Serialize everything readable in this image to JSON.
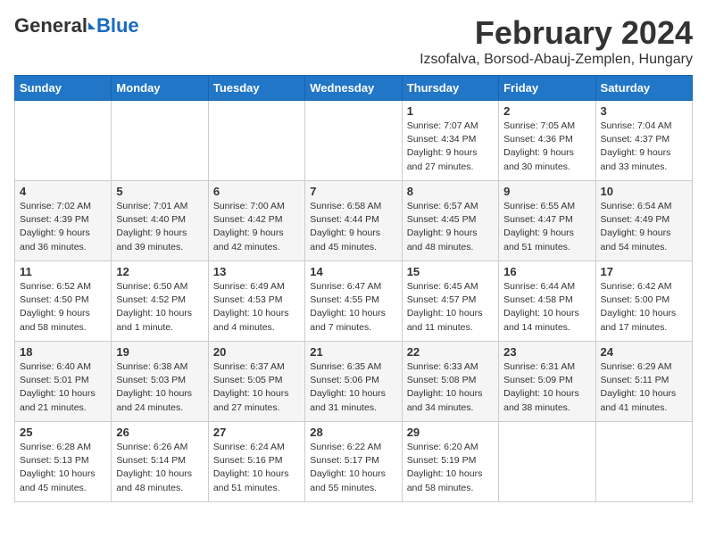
{
  "logo": {
    "general": "General",
    "blue": "Blue"
  },
  "header": {
    "title": "February 2024",
    "subtitle": "Izsofalva, Borsod-Abauj-Zemplen, Hungary"
  },
  "weekdays": [
    "Sunday",
    "Monday",
    "Tuesday",
    "Wednesday",
    "Thursday",
    "Friday",
    "Saturday"
  ],
  "weeks": [
    [
      {
        "day": "",
        "info": ""
      },
      {
        "day": "",
        "info": ""
      },
      {
        "day": "",
        "info": ""
      },
      {
        "day": "",
        "info": ""
      },
      {
        "day": "1",
        "info": "Sunrise: 7:07 AM\nSunset: 4:34 PM\nDaylight: 9 hours and 27 minutes."
      },
      {
        "day": "2",
        "info": "Sunrise: 7:05 AM\nSunset: 4:36 PM\nDaylight: 9 hours and 30 minutes."
      },
      {
        "day": "3",
        "info": "Sunrise: 7:04 AM\nSunset: 4:37 PM\nDaylight: 9 hours and 33 minutes."
      }
    ],
    [
      {
        "day": "4",
        "info": "Sunrise: 7:02 AM\nSunset: 4:39 PM\nDaylight: 9 hours and 36 minutes."
      },
      {
        "day": "5",
        "info": "Sunrise: 7:01 AM\nSunset: 4:40 PM\nDaylight: 9 hours and 39 minutes."
      },
      {
        "day": "6",
        "info": "Sunrise: 7:00 AM\nSunset: 4:42 PM\nDaylight: 9 hours and 42 minutes."
      },
      {
        "day": "7",
        "info": "Sunrise: 6:58 AM\nSunset: 4:44 PM\nDaylight: 9 hours and 45 minutes."
      },
      {
        "day": "8",
        "info": "Sunrise: 6:57 AM\nSunset: 4:45 PM\nDaylight: 9 hours and 48 minutes."
      },
      {
        "day": "9",
        "info": "Sunrise: 6:55 AM\nSunset: 4:47 PM\nDaylight: 9 hours and 51 minutes."
      },
      {
        "day": "10",
        "info": "Sunrise: 6:54 AM\nSunset: 4:49 PM\nDaylight: 9 hours and 54 minutes."
      }
    ],
    [
      {
        "day": "11",
        "info": "Sunrise: 6:52 AM\nSunset: 4:50 PM\nDaylight: 9 hours and 58 minutes."
      },
      {
        "day": "12",
        "info": "Sunrise: 6:50 AM\nSunset: 4:52 PM\nDaylight: 10 hours and 1 minute."
      },
      {
        "day": "13",
        "info": "Sunrise: 6:49 AM\nSunset: 4:53 PM\nDaylight: 10 hours and 4 minutes."
      },
      {
        "day": "14",
        "info": "Sunrise: 6:47 AM\nSunset: 4:55 PM\nDaylight: 10 hours and 7 minutes."
      },
      {
        "day": "15",
        "info": "Sunrise: 6:45 AM\nSunset: 4:57 PM\nDaylight: 10 hours and 11 minutes."
      },
      {
        "day": "16",
        "info": "Sunrise: 6:44 AM\nSunset: 4:58 PM\nDaylight: 10 hours and 14 minutes."
      },
      {
        "day": "17",
        "info": "Sunrise: 6:42 AM\nSunset: 5:00 PM\nDaylight: 10 hours and 17 minutes."
      }
    ],
    [
      {
        "day": "18",
        "info": "Sunrise: 6:40 AM\nSunset: 5:01 PM\nDaylight: 10 hours and 21 minutes."
      },
      {
        "day": "19",
        "info": "Sunrise: 6:38 AM\nSunset: 5:03 PM\nDaylight: 10 hours and 24 minutes."
      },
      {
        "day": "20",
        "info": "Sunrise: 6:37 AM\nSunset: 5:05 PM\nDaylight: 10 hours and 27 minutes."
      },
      {
        "day": "21",
        "info": "Sunrise: 6:35 AM\nSunset: 5:06 PM\nDaylight: 10 hours and 31 minutes."
      },
      {
        "day": "22",
        "info": "Sunrise: 6:33 AM\nSunset: 5:08 PM\nDaylight: 10 hours and 34 minutes."
      },
      {
        "day": "23",
        "info": "Sunrise: 6:31 AM\nSunset: 5:09 PM\nDaylight: 10 hours and 38 minutes."
      },
      {
        "day": "24",
        "info": "Sunrise: 6:29 AM\nSunset: 5:11 PM\nDaylight: 10 hours and 41 minutes."
      }
    ],
    [
      {
        "day": "25",
        "info": "Sunrise: 6:28 AM\nSunset: 5:13 PM\nDaylight: 10 hours and 45 minutes."
      },
      {
        "day": "26",
        "info": "Sunrise: 6:26 AM\nSunset: 5:14 PM\nDaylight: 10 hours and 48 minutes."
      },
      {
        "day": "27",
        "info": "Sunrise: 6:24 AM\nSunset: 5:16 PM\nDaylight: 10 hours and 51 minutes."
      },
      {
        "day": "28",
        "info": "Sunrise: 6:22 AM\nSunset: 5:17 PM\nDaylight: 10 hours and 55 minutes."
      },
      {
        "day": "29",
        "info": "Sunrise: 6:20 AM\nSunset: 5:19 PM\nDaylight: 10 hours and 58 minutes."
      },
      {
        "day": "",
        "info": ""
      },
      {
        "day": "",
        "info": ""
      }
    ]
  ]
}
